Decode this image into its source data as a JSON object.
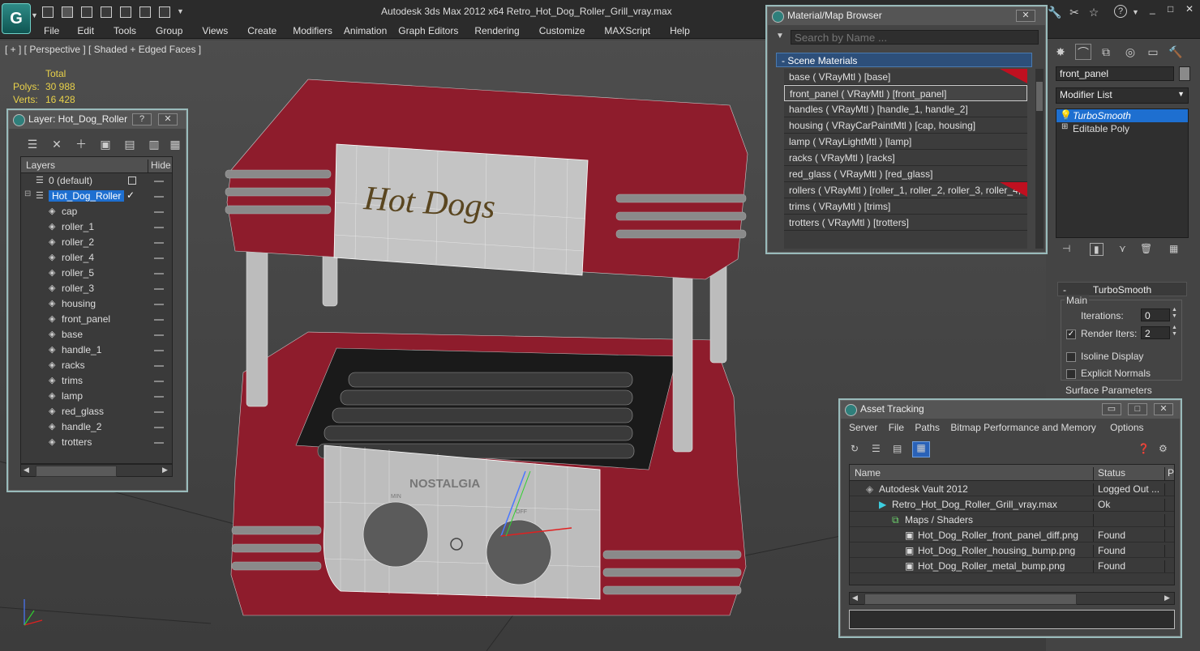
{
  "app": {
    "title": "Autodesk 3ds Max  2012 x64      Retro_Hot_Dog_Roller_Grill_vray.max",
    "logo_glyph": "G",
    "menu": [
      "File",
      "Edit",
      "Tools",
      "Group",
      "Views",
      "Create",
      "Modifiers",
      "Animation",
      "Graph Editors",
      "Rendering",
      "Customize",
      "MAXScript",
      "Help"
    ],
    "help_glyph": "?",
    "window_controls": [
      "_",
      "□",
      "✕"
    ]
  },
  "viewport": {
    "label": "[ + ] [ Perspective ] [ Shaded + Edged Faces ]",
    "stats": {
      "header": "Total",
      "polys_label": "Polys:",
      "polys": "30 988",
      "verts_label": "Verts:",
      "verts": "16 428"
    },
    "model_text": {
      "sign": "Hot Dogs",
      "brand": "NOSTALGIA",
      "dial_left": "MIN",
      "dial_right": "OFF"
    },
    "colors": {
      "body": "#8e1c2c",
      "panel": "#b9b9b9",
      "trim": "#8a8a8a"
    }
  },
  "layer_window": {
    "title": "Layer: Hot_Dog_Roller",
    "help": "?",
    "close": "✕",
    "columns": {
      "layers": "Layers",
      "hide": "Hide"
    },
    "rows": [
      {
        "name": "0 (default)",
        "level": 0
      },
      {
        "name": "Hot_Dog_Roller",
        "level": 0,
        "selected": true,
        "check": "✓"
      },
      {
        "name": "cap",
        "level": 1
      },
      {
        "name": "roller_1",
        "level": 1
      },
      {
        "name": "roller_2",
        "level": 1
      },
      {
        "name": "roller_4",
        "level": 1
      },
      {
        "name": "roller_5",
        "level": 1
      },
      {
        "name": "roller_3",
        "level": 1
      },
      {
        "name": "housing",
        "level": 1
      },
      {
        "name": "front_panel",
        "level": 1
      },
      {
        "name": "base",
        "level": 1
      },
      {
        "name": "handle_1",
        "level": 1
      },
      {
        "name": "racks",
        "level": 1
      },
      {
        "name": "trims",
        "level": 1
      },
      {
        "name": "lamp",
        "level": 1
      },
      {
        "name": "red_glass",
        "level": 1
      },
      {
        "name": "handle_2",
        "level": 1
      },
      {
        "name": "trotters",
        "level": 1
      }
    ]
  },
  "material_browser": {
    "title": "Material/Map Browser",
    "close": "✕",
    "search_placeholder": "Search by Name ...",
    "section": "- Scene Materials",
    "items": [
      {
        "label": "base  ( VRayMtl ) [base]",
        "swatch": true
      },
      {
        "label": "front_panel  ( VRayMtl ) [front_panel]",
        "selected": true
      },
      {
        "label": "handles  ( VRayMtl ) [handle_1, handle_2]"
      },
      {
        "label": "housing  ( VRayCarPaintMtl ) [cap, housing]"
      },
      {
        "label": "lamp  ( VRayLightMtl ) [lamp]"
      },
      {
        "label": "racks  ( VRayMtl ) [racks]"
      },
      {
        "label": "red_glass  ( VRayMtl ) [red_glass]"
      },
      {
        "label": "rollers  ( VRayMtl ) [roller_1, roller_2, roller_3, roller_4,...",
        "swatch": true
      },
      {
        "label": "trims  ( VRayMtl ) [trims]"
      },
      {
        "label": "trotters  ( VRayMtl ) [trotters]"
      }
    ]
  },
  "command_panel": {
    "object_name": "front_panel",
    "modifier_list": "Modifier List",
    "stack": [
      {
        "label": "TurboSmooth",
        "selected": true
      },
      {
        "label": "Editable Poly"
      }
    ],
    "turbosmooth": {
      "title": "TurboSmooth",
      "group_main": "Main",
      "iterations_label": "Iterations:",
      "iterations": "0",
      "render_iters_label": "Render Iters:",
      "render_iters": "2",
      "render_iters_checked": true,
      "isoline_label": "Isoline Display",
      "explicit_normals_label": "Explicit Normals",
      "surface_params": "Surface Parameters"
    }
  },
  "asset_tracking": {
    "title": "Asset Tracking",
    "minimize": "▭",
    "maximize": "□",
    "close": "✕",
    "menu": [
      "Server",
      "File",
      "Paths",
      "Bitmap Performance and Memory",
      "Options"
    ],
    "columns": {
      "name": "Name",
      "status": "Status",
      "p": "P"
    },
    "rows": [
      {
        "name": "Autodesk Vault 2012",
        "status": "Logged Out ...",
        "level": 0
      },
      {
        "name": "Retro_Hot_Dog_Roller_Grill_vray.max",
        "status": "Ok",
        "level": 1
      },
      {
        "name": "Maps / Shaders",
        "status": "",
        "level": 2
      },
      {
        "name": "Hot_Dog_Roller_front_panel_diff.png",
        "status": "Found",
        "level": 3
      },
      {
        "name": "Hot_Dog_Roller_housing_bump.png",
        "status": "Found",
        "level": 3
      },
      {
        "name": "Hot_Dog_Roller_metal_bump.png",
        "status": "Found",
        "level": 3
      }
    ]
  }
}
